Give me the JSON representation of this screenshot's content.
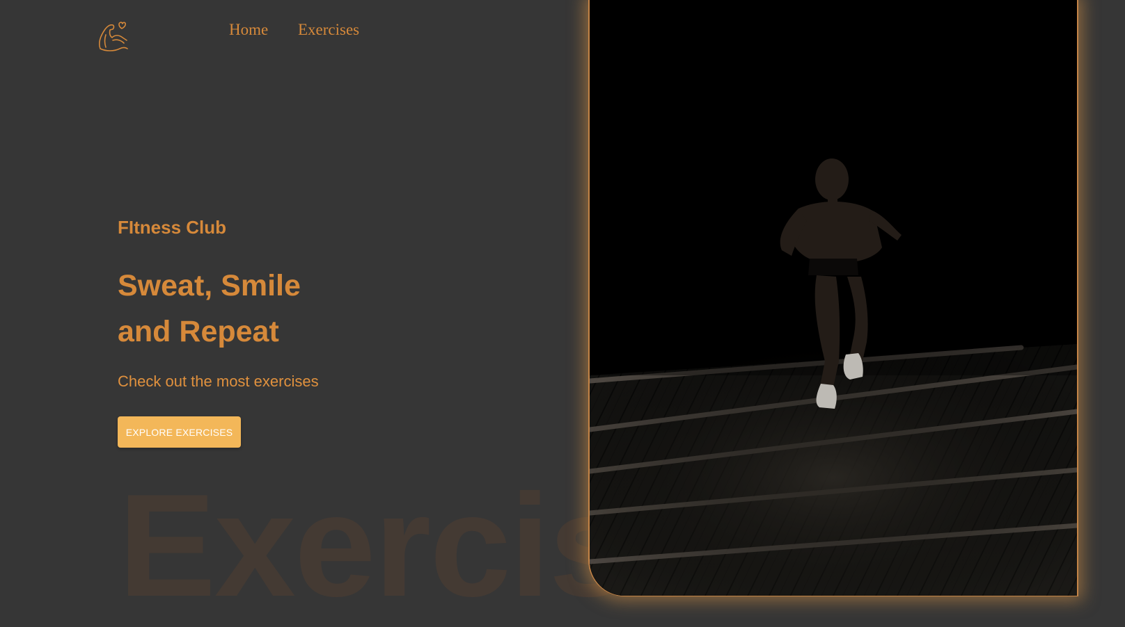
{
  "nav": {
    "logo_icon": "flexed-bicep-heart-icon",
    "links": [
      {
        "label": "Home"
      },
      {
        "label": "Exercises"
      }
    ]
  },
  "hero": {
    "kicker": "FItness Club",
    "headline_line1": "Sweat, Smile",
    "headline_line2": "and Repeat",
    "subtext": "Check out the most exercises",
    "cta_label": "EXPLORE EXERCISES"
  },
  "background_word": "Exercise",
  "hero_image": {
    "subject": "athlete-running-up-steps-icon"
  },
  "colors": {
    "page_background": "#363636",
    "accent": "#d6893a",
    "button": "#f3b759",
    "button_text": "#ffffff",
    "watermark": "#443a33"
  }
}
